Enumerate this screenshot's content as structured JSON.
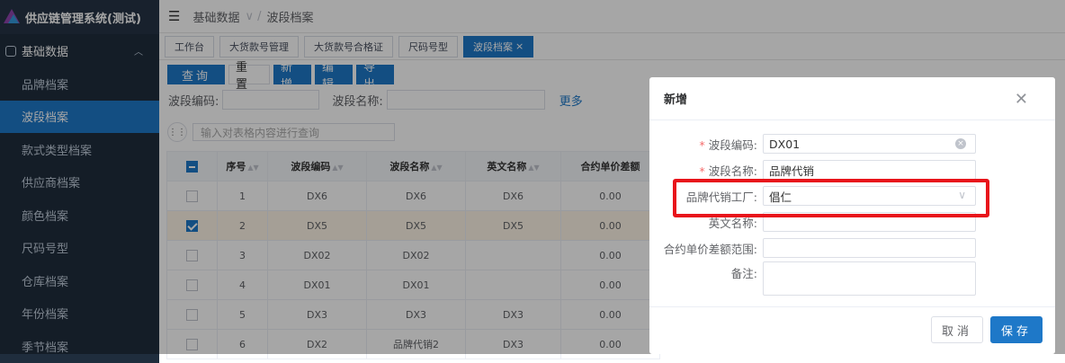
{
  "app": {
    "title": "供应链管理系统(测试)"
  },
  "sidebar": {
    "group_label": "基础数据",
    "items": [
      {
        "label": "品牌档案"
      },
      {
        "label": "波段档案"
      },
      {
        "label": "款式类型档案"
      },
      {
        "label": "供应商档案"
      },
      {
        "label": "颜色档案"
      },
      {
        "label": "尺码号型"
      },
      {
        "label": "仓库档案"
      },
      {
        "label": "年份档案"
      },
      {
        "label": "季节档案"
      }
    ]
  },
  "breadcrumb": {
    "parent": "基础数据",
    "current": "波段档案"
  },
  "tabs": [
    {
      "label": "工作台"
    },
    {
      "label": "大货款号管理"
    },
    {
      "label": "大货款号合格证"
    },
    {
      "label": "尺码号型"
    },
    {
      "label": "波段档案"
    }
  ],
  "toolbar": {
    "query": "查询",
    "reset": "重置",
    "add": "新增",
    "edit": "编辑",
    "export": "导出"
  },
  "search": {
    "code_label": "波段编码:",
    "name_label": "波段名称:",
    "more": "更多",
    "filter_placeholder": "输入对表格内容进行查询"
  },
  "table": {
    "headers": [
      "序号",
      "波段编码",
      "波段名称",
      "英文名称",
      "合约单价差额"
    ],
    "rows": [
      {
        "no": "1",
        "code": "DX6",
        "name": "DX6",
        "en": "DX6",
        "diff": "0.00",
        "checked": false
      },
      {
        "no": "2",
        "code": "DX5",
        "name": "DX5",
        "en": "DX5",
        "diff": "0.00",
        "checked": true
      },
      {
        "no": "3",
        "code": "DX02",
        "name": "DX02",
        "en": "",
        "diff": "0.00",
        "checked": false
      },
      {
        "no": "4",
        "code": "DX01",
        "name": "DX01",
        "en": "",
        "diff": "0.00",
        "checked": false
      },
      {
        "no": "5",
        "code": "DX3",
        "name": "DX3",
        "en": "DX3",
        "diff": "0.00",
        "checked": false
      },
      {
        "no": "6",
        "code": "DX2",
        "name": "品牌代销2",
        "en": "DX3",
        "diff": "0.00",
        "checked": false
      }
    ]
  },
  "dialog": {
    "title": "新增",
    "fields": {
      "code_label": "波段编码:",
      "code_value": "DX01",
      "name_label": "波段名称:",
      "name_value": "品牌代销",
      "factory_label": "品牌代销工厂:",
      "factory_value": "倡仁",
      "en_label": "英文名称:",
      "diff_label": "合约单价差额范围:",
      "remark_label": "备注:"
    },
    "cancel": "取消",
    "save": "保存"
  },
  "colors": {
    "accent": "#1e78c8",
    "sidebar_bg": "#1f2d3d",
    "highlight": "#e8141b"
  }
}
